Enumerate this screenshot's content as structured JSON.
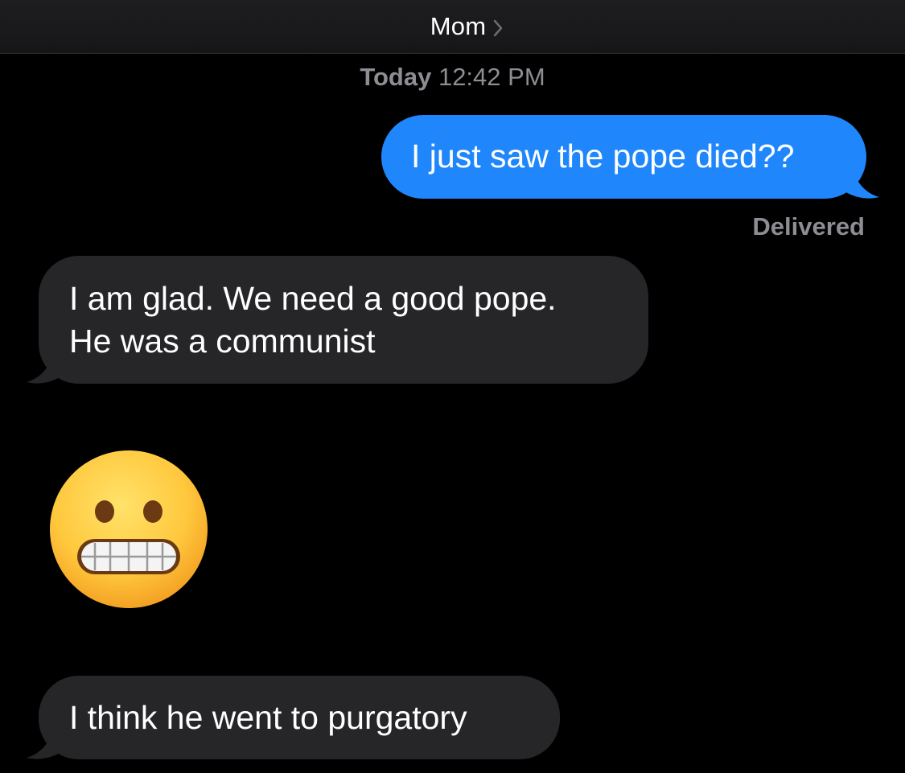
{
  "header": {
    "contact_name": "Mom",
    "chevron_icon": "chevron-right-icon"
  },
  "thread": {
    "timestamp_day": "Today",
    "timestamp_time": "12:42 PM",
    "messages": [
      {
        "direction": "outgoing",
        "lines": [
          "I just saw the pope died??"
        ]
      },
      {
        "direction": "incoming",
        "lines": [
          "I am glad. We need a good pope.",
          "He was a communist"
        ]
      },
      {
        "direction": "incoming",
        "type": "emoji",
        "emoji": "grimacing-face-icon"
      },
      {
        "direction": "incoming",
        "lines": [
          "I think he went to purgatory"
        ]
      }
    ],
    "delivery_status": "Delivered"
  },
  "colors": {
    "background": "#000000",
    "outgoing_bubble": "#1f87fb",
    "incoming_bubble": "#262629",
    "secondary_text": "#8d8d93",
    "emoji_face": "#ffc83d"
  }
}
